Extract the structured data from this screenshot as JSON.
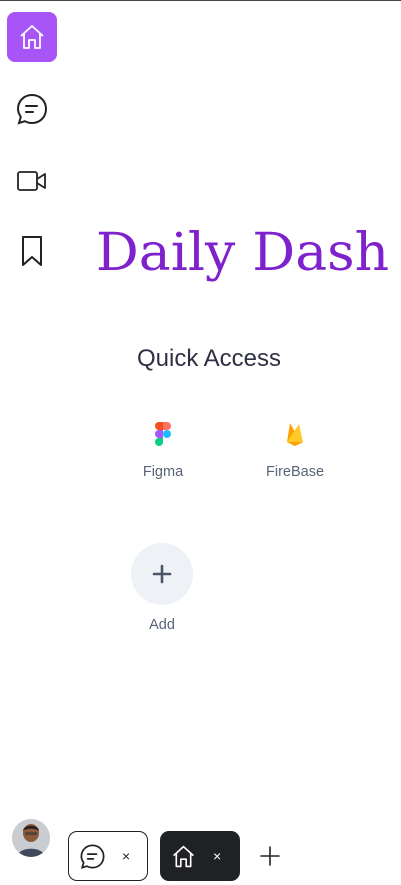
{
  "app": {
    "title": "Daily Dash"
  },
  "sidebar": {
    "items": [
      {
        "icon": "home-icon",
        "active": true
      },
      {
        "icon": "chat-icon",
        "active": false
      },
      {
        "icon": "video-icon",
        "active": false
      },
      {
        "icon": "bookmark-icon",
        "active": false
      }
    ]
  },
  "quick_access": {
    "heading": "Quick Access",
    "shortcuts": [
      {
        "label": "Figma",
        "icon": "figma-icon"
      },
      {
        "label": "FireBase",
        "icon": "firebase-icon"
      }
    ],
    "add_label": "Add"
  },
  "dock": {
    "tabs": [
      {
        "icon": "chat-icon",
        "close": "×",
        "active": false
      },
      {
        "icon": "home-icon",
        "close": "×",
        "active": true
      }
    ],
    "new_tab_icon": "plus-icon"
  },
  "colors": {
    "accent": "#a855f7",
    "title": "#7e22ce",
    "dark_tab": "#1f2124"
  }
}
